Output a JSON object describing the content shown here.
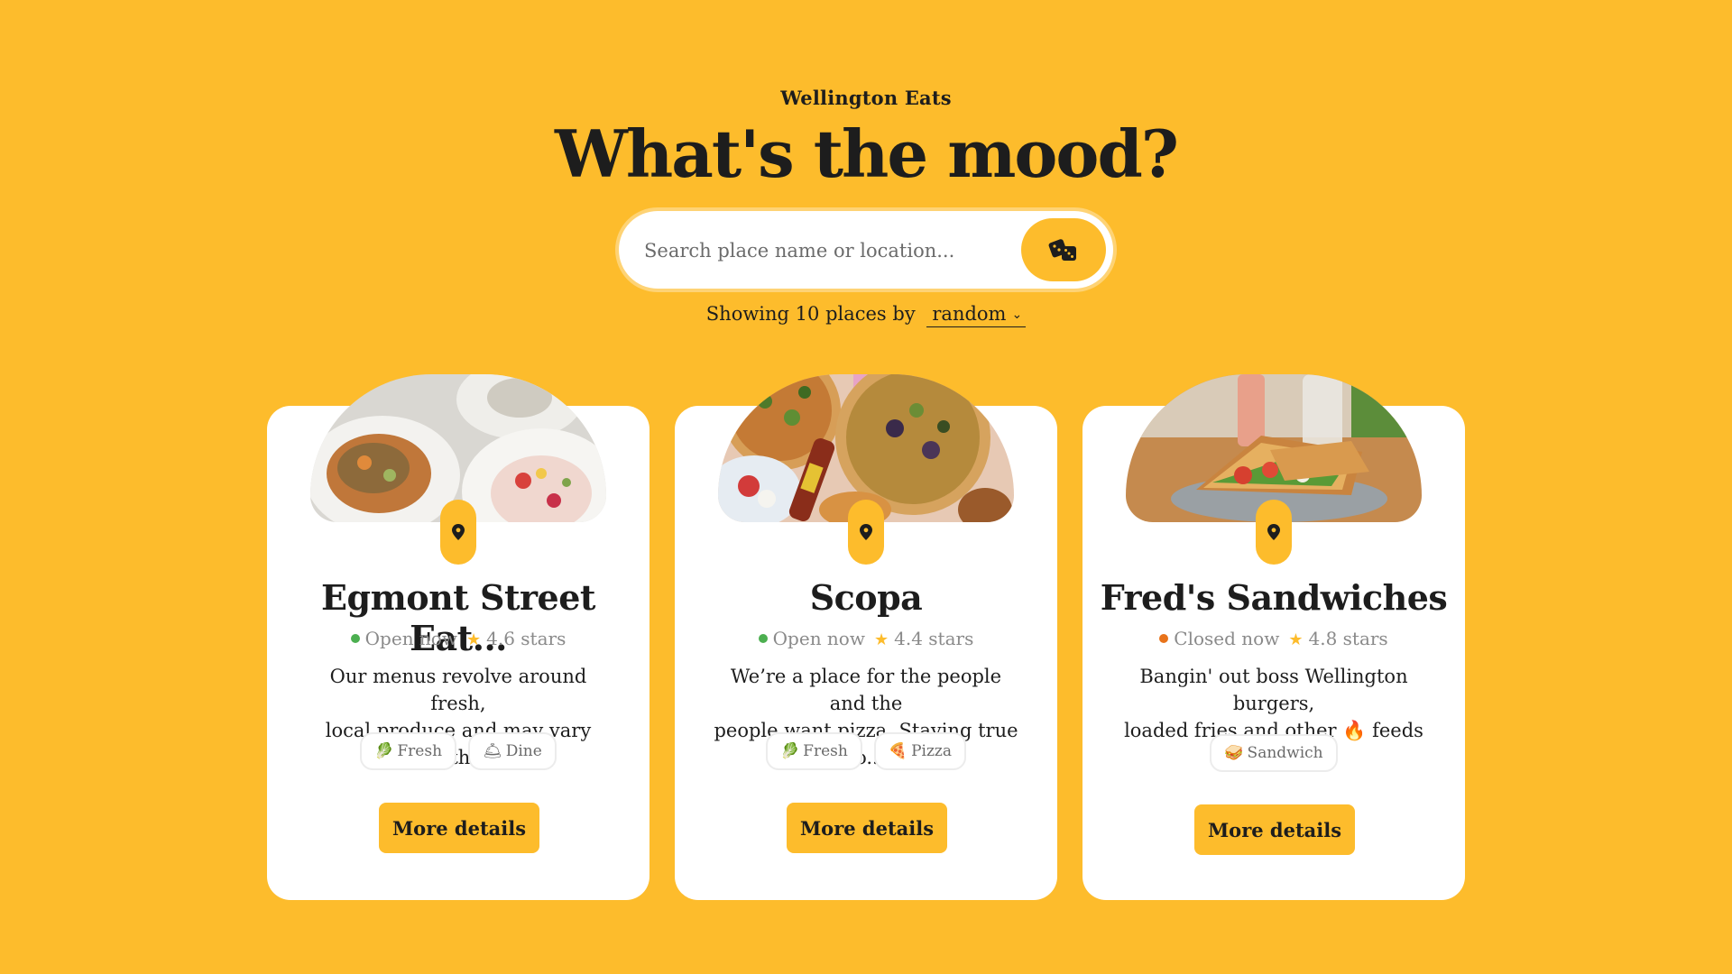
{
  "brand": "Wellington Eats",
  "headline": "What's the mood?",
  "search": {
    "placeholder": "Search place name or location...",
    "random_icon": "dice-icon"
  },
  "sort": {
    "prefix": "Showing 10 places by",
    "selected": "random",
    "chevron": "⌄"
  },
  "colors": {
    "background": "#FDBC2C",
    "accent": "#FDBC2C",
    "open": "#4CAF50",
    "closed": "#E8731A"
  },
  "cards": [
    {
      "title": "Egmont Street Eat...",
      "status": "Open now",
      "status_type": "open",
      "rating": "4.6 stars",
      "desc_line1": "Our menus revolve around fresh,",
      "desc_line2": "local produce and may vary with...",
      "tags": [
        {
          "emoji": "🥬",
          "label": "Fresh"
        },
        {
          "emoji": "🛎",
          "label": "Dine"
        }
      ],
      "button": "More details",
      "image": "food-bowls-photo"
    },
    {
      "title": "Scopa",
      "status": "Open now",
      "status_type": "open",
      "rating": "4.4 stars",
      "desc_line1": "We’re a place for the people and the",
      "desc_line2": "people want pizza. Staying true to...",
      "tags": [
        {
          "emoji": "🥬",
          "label": "Fresh"
        },
        {
          "emoji": "🍕",
          "label": "Pizza"
        }
      ],
      "button": "More details",
      "image": "pizza-photo"
    },
    {
      "title": "Fred's Sandwiches",
      "status": "Closed now",
      "status_type": "closed",
      "rating": "4.8 stars",
      "desc_line1": "Bangin' out boss Wellington burgers,",
      "desc_line2": "loaded fries and other 🔥 feeds just..",
      "tags": [
        {
          "emoji": "🥪",
          "label": "Sandwich"
        }
      ],
      "button": "More details",
      "image": "sandwich-photo"
    }
  ]
}
